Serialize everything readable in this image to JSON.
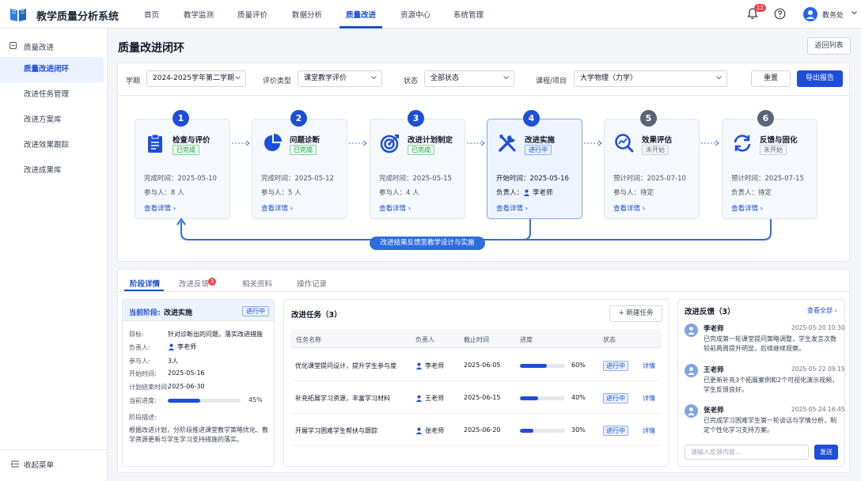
{
  "app": {
    "title": "教学质量分析系统",
    "notif_count": "12",
    "user": "教务处"
  },
  "nav": [
    "首页",
    "教学监测",
    "质量评价",
    "数据分析",
    "质量改进",
    "资源中心",
    "系统管理"
  ],
  "sidebar": {
    "group": "质量改进",
    "items": [
      "质量改进闭环",
      "改进任务管理",
      "改进方案库",
      "改进效果跟踪",
      "改进成果库"
    ],
    "collapse": "收起菜单"
  },
  "page": {
    "title": "质量改进闭环",
    "back": "返回列表"
  },
  "filters": {
    "term_label": "学期",
    "term": "2024-2025学年第二学期",
    "type_label": "评价类型",
    "type": "课堂教学评价",
    "status_label": "状态",
    "status": "全部状态",
    "course_label": "课程/项目",
    "course": "大学物理（力学）",
    "reset": "重置",
    "export": "导出报告"
  },
  "steps": [
    {
      "num": "1",
      "name": "检查与评价",
      "badge": "已完成",
      "l1": "完成时间：2025-05-10",
      "l2": "参与人：8 人",
      "link": "查看详情"
    },
    {
      "num": "2",
      "name": "问题诊断",
      "badge": "已完成",
      "l1": "完成时间：2025-05-12",
      "l2": "参与人：5 人",
      "link": "查看详情"
    },
    {
      "num": "3",
      "name": "改进计划制定",
      "badge": "已完成",
      "l1": "完成时间：2025-05-15",
      "l2": "参与人：4 人",
      "link": "查看详情"
    },
    {
      "num": "4",
      "name": "改进实施",
      "badge": "进行中",
      "l1": "开始时间：2025-05-16",
      "l2": "负责人：",
      "l2b": "李老师",
      "link": "查看详情"
    },
    {
      "num": "5",
      "name": "效果评估",
      "badge": "未开始",
      "l1": "预计时间：2025-07-10",
      "l2": "参与人：待定",
      "link": "查看详情"
    },
    {
      "num": "6",
      "name": "反馈与固化",
      "badge": "未开始",
      "l1": "预计时间：2025-07-15",
      "l2": "负责人：待定",
      "link": "查看详情"
    }
  ],
  "loop_label": "改进结果反馈至教学设计与实施",
  "tabs": {
    "t1": "阶段详情",
    "t2": "改进反馈",
    "t2_count": "3",
    "t3": "相关资料",
    "t4": "操作记录"
  },
  "stage": {
    "cur_label": "当前阶段:",
    "cur_name": "改进实施",
    "badge": "进行中",
    "goal_k": "目标:",
    "goal_v": "针对诊断出的问题，落实改进措施",
    "owner_k": "负责人:",
    "owner_v": "李老师",
    "members_k": "参与人:",
    "members_v": "3人",
    "start_k": "开始时间:",
    "start_v": "2025-05-16",
    "end_k": "计划结束时间:",
    "end_v": "2025-06-30",
    "progress_k": "当前进度:",
    "progress": 45,
    "progress_text": "45%",
    "desc_k": "阶段描述:",
    "desc": "根据改进计划，分阶段推进课堂教学策略优化、教学资源更新与学生学习支持措施的落实。"
  },
  "tasks": {
    "title": "改进任务（3）",
    "new": "新建任务",
    "headers": [
      "任务名称",
      "负责人",
      "截止时间",
      "进度",
      "状态"
    ],
    "rows": [
      {
        "name": "优化课堂提问设计，提升学生参与度",
        "owner": "李老师",
        "due": "2025-06-05",
        "progress": 60,
        "pct": "60%",
        "status": "进行中",
        "link": "详情"
      },
      {
        "name": "补充拓展学习资源，丰富学习材料",
        "owner": "王老师",
        "due": "2025-06-15",
        "progress": 40,
        "pct": "40%",
        "status": "进行中",
        "link": "详情"
      },
      {
        "name": "开展学习困难学生帮扶与跟踪",
        "owner": "张老师",
        "due": "2025-06-20",
        "progress": 30,
        "pct": "30%",
        "status": "进行中",
        "link": "详情"
      }
    ]
  },
  "feedback": {
    "title": "改进反馈（3）",
    "view_all": "查看全部",
    "items": [
      {
        "name": "李老师",
        "time": "2025-05-20 10:30",
        "text": "已完成第一轮课堂提问策略调整，学生发言次数较前两周提升明显，后续继续观察。"
      },
      {
        "name": "王老师",
        "time": "2025-05-22 09:15",
        "text": "已更新补充3个拓展案例和2个可视化演示视频，学生反馈良好。"
      },
      {
        "name": "张老师",
        "time": "2025-05-24 16:45",
        "text": "已完成学习困难学生第一轮谈话与学情分析，制定个性化学习支持方案。"
      }
    ],
    "placeholder": "请输入反馈内容...",
    "send": "发送"
  },
  "colors": {
    "primary": "#1d4ed8",
    "done": "#16a34a",
    "pending": "#6b7280"
  }
}
